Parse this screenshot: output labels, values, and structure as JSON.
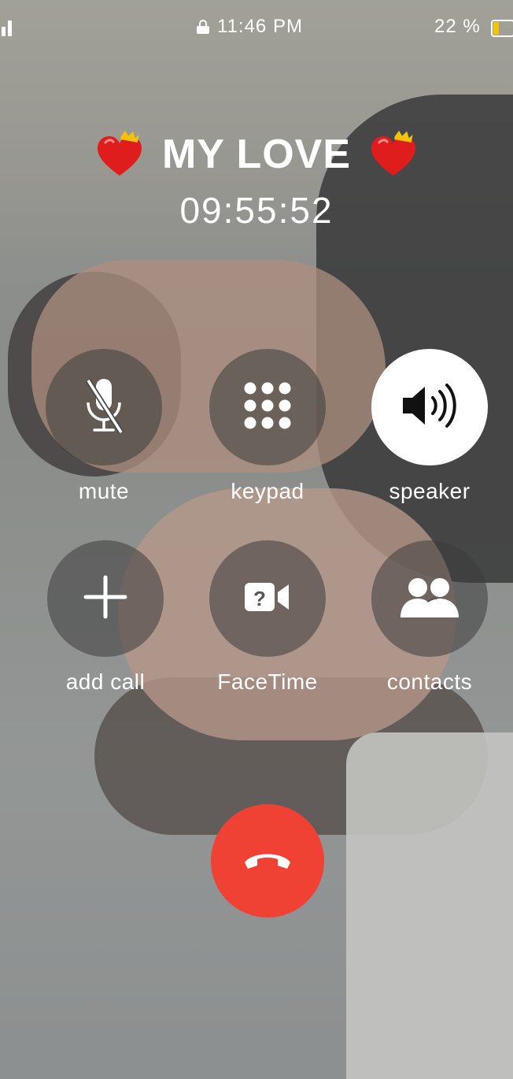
{
  "status_bar": {
    "time": "11:46 PM",
    "battery_percent": "22 %",
    "battery_level": 0.22,
    "lock_icon": "lock-icon",
    "signal_icon": "signal-icon"
  },
  "call": {
    "caller_name": "MY LOVE",
    "duration": "09:55:52",
    "caller_decoration_icon": "crowned-heart-icon"
  },
  "controls": [
    {
      "id": "mute",
      "label": "mute",
      "icon": "mic-off-icon",
      "active": false
    },
    {
      "id": "keypad",
      "label": "keypad",
      "icon": "keypad-icon",
      "active": false
    },
    {
      "id": "speaker",
      "label": "speaker",
      "icon": "speaker-icon",
      "active": true
    },
    {
      "id": "add-call",
      "label": "add call",
      "icon": "plus-icon",
      "active": false
    },
    {
      "id": "facetime",
      "label": "FaceTime",
      "icon": "facetime-question-icon",
      "active": false
    },
    {
      "id": "contacts",
      "label": "contacts",
      "icon": "contacts-icon",
      "active": false
    }
  ],
  "end_call": {
    "icon": "end-call-icon",
    "color": "#f04135"
  },
  "colors": {
    "battery_fill": "#f2c500",
    "end_call": "#f04135"
  }
}
